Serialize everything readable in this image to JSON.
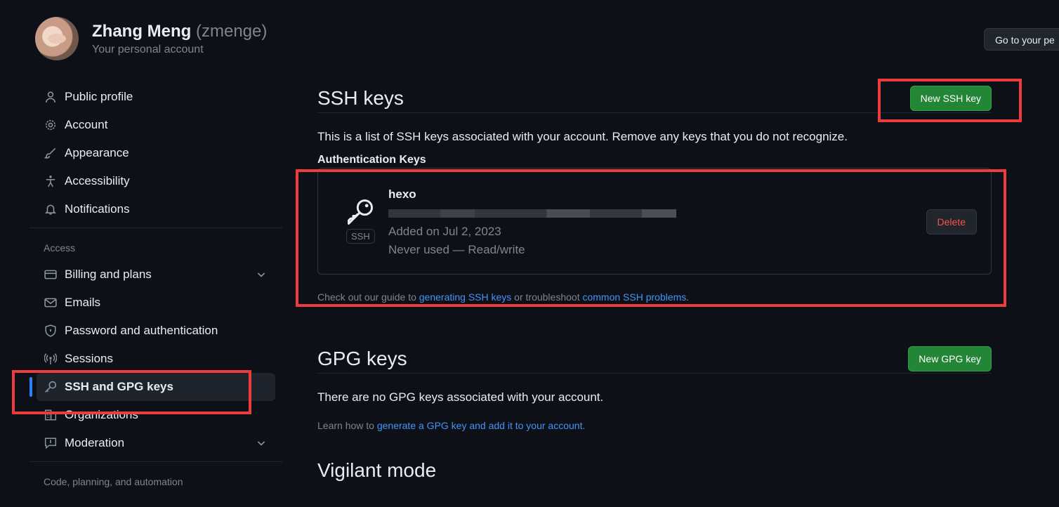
{
  "profile": {
    "name": "Zhang Meng",
    "handle": "(zmenge)",
    "subtitle": "Your personal account",
    "go_button": "Go to your pe"
  },
  "sidebar": {
    "items_top": [
      {
        "label": "Public profile",
        "icon": "person-icon"
      },
      {
        "label": "Account",
        "icon": "gear-icon"
      },
      {
        "label": "Appearance",
        "icon": "paintbrush-icon"
      },
      {
        "label": "Accessibility",
        "icon": "accessibility-icon"
      },
      {
        "label": "Notifications",
        "icon": "bell-icon"
      }
    ],
    "section_access": "Access",
    "items_access": [
      {
        "label": "Billing and plans",
        "icon": "credit-card-icon"
      },
      {
        "label": "Emails",
        "icon": "mail-icon"
      },
      {
        "label": "Password and authentication",
        "icon": "shield-lock-icon"
      },
      {
        "label": "Sessions",
        "icon": "broadcast-icon"
      },
      {
        "label": "SSH and GPG keys",
        "icon": "key-icon",
        "active": true
      },
      {
        "label": "Organizations",
        "icon": "organization-icon"
      },
      {
        "label": "Moderation",
        "icon": "report-icon"
      }
    ],
    "section_code": "Code, planning, and automation"
  },
  "ssh": {
    "title": "SSH keys",
    "new_button": "New SSH key",
    "description": "This is a list of SSH keys associated with your account. Remove any keys that you do not recognize.",
    "auth_heading": "Authentication Keys",
    "key": {
      "name": "hexo",
      "badge": "SSH",
      "added": "Added on Jul 2, 2023",
      "usage": "Never used — Read/write",
      "delete_label": "Delete"
    },
    "note_prefix": "Check out our guide to ",
    "note_link1": "generating SSH keys",
    "note_mid": " or troubleshoot ",
    "note_link2": "common SSH problems",
    "note_suffix": "."
  },
  "gpg": {
    "title": "GPG keys",
    "new_button": "New GPG key",
    "description": "There are no GPG keys associated with your account.",
    "note_prefix": "Learn how to ",
    "note_link": "generate a GPG key and add it to your account",
    "note_suffix": "."
  },
  "vigilant": {
    "title": "Vigilant mode"
  },
  "colors": {
    "accent": "#2f81f7",
    "green": "#238636",
    "danger": "#f85149",
    "highlight": "#ee3b3b"
  }
}
